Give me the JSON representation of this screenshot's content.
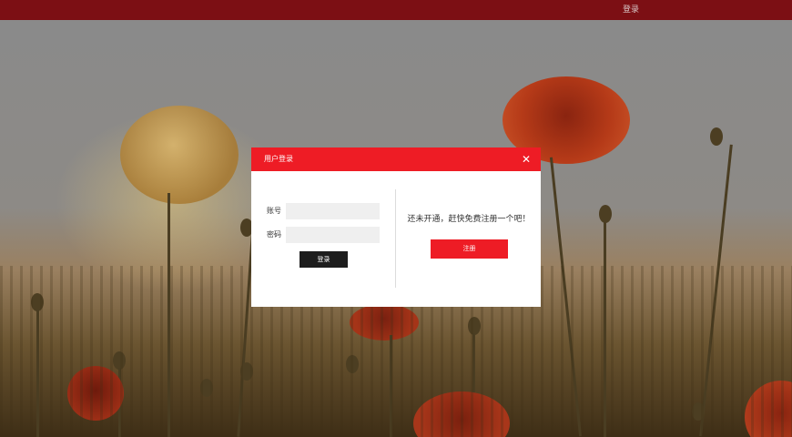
{
  "topbar": {
    "login_link": "登录"
  },
  "modal": {
    "title": "用户登录",
    "close_symbol": "✕",
    "account_label": "账号",
    "password_label": "密码",
    "account_value": "",
    "password_value": "",
    "login_button": "登录",
    "promo_text": "还未开通，赶快免费注册一个吧！",
    "register_button": "注册"
  },
  "colors": {
    "topbar": "#7c0f14",
    "modal_header": "#ee1c25",
    "register_button": "#ee1c25",
    "login_button": "#1d1d1d",
    "input_background": "#efefef"
  },
  "icons": {
    "close": "close-icon"
  }
}
